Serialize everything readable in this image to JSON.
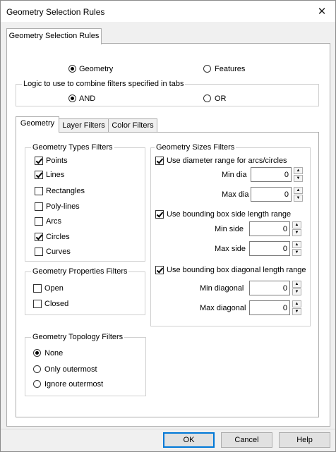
{
  "window": {
    "title": "Geometry Selection Rules",
    "close_glyph": "✕"
  },
  "outer_tab": {
    "label": "Geometry Selection Rules"
  },
  "mode": {
    "options": [
      {
        "label": "Geometry",
        "selected": true
      },
      {
        "label": "Features",
        "selected": false
      }
    ]
  },
  "logic": {
    "title": "Logic to use to combine filters specified in tabs",
    "options": [
      {
        "label": "AND",
        "selected": true
      },
      {
        "label": "OR",
        "selected": false
      }
    ]
  },
  "tabs": [
    {
      "label": "Geometry",
      "active": true
    },
    {
      "label": "Layer Filters",
      "active": false
    },
    {
      "label": "Color Filters",
      "active": false
    }
  ],
  "types": {
    "title": "Geometry Types Filters",
    "items": [
      {
        "label": "Points",
        "checked": true
      },
      {
        "label": "Lines",
        "checked": true
      },
      {
        "label": "Rectangles",
        "checked": false
      },
      {
        "label": "Poly-lines",
        "checked": false
      },
      {
        "label": "Arcs",
        "checked": false
      },
      {
        "label": "Circles",
        "checked": true
      },
      {
        "label": "Curves",
        "checked": false
      }
    ]
  },
  "properties": {
    "title": "Geometry Properties Filters",
    "items": [
      {
        "label": "Open",
        "checked": false
      },
      {
        "label": "Closed",
        "checked": false
      }
    ]
  },
  "topology": {
    "title": "Geometry Topology Filters",
    "items": [
      {
        "label": "None",
        "selected": true
      },
      {
        "label": "Only outermost",
        "selected": false
      },
      {
        "label": "Ignore outermost",
        "selected": false
      }
    ]
  },
  "sizes": {
    "title": "Geometry Sizes Filters",
    "diameter": {
      "label": "Use diameter range for arcs/circles",
      "checked": true,
      "min_label": "Min dia",
      "min_value": "0",
      "max_label": "Max dia",
      "max_value": "0"
    },
    "side": {
      "label": "Use bounding box side length range",
      "checked": true,
      "min_label": "Min side",
      "min_value": "0",
      "max_label": "Max side",
      "max_value": "0"
    },
    "diagonal": {
      "label": "Use bounding box diagonal length range",
      "checked": true,
      "min_label": "Min diagonal",
      "min_value": "0",
      "max_label": "Max diagonal",
      "max_value": "0"
    }
  },
  "buttons": {
    "ok": "OK",
    "cancel": "Cancel",
    "help": "Help"
  },
  "spin_glyphs": {
    "up": "▲",
    "down": "▼"
  }
}
